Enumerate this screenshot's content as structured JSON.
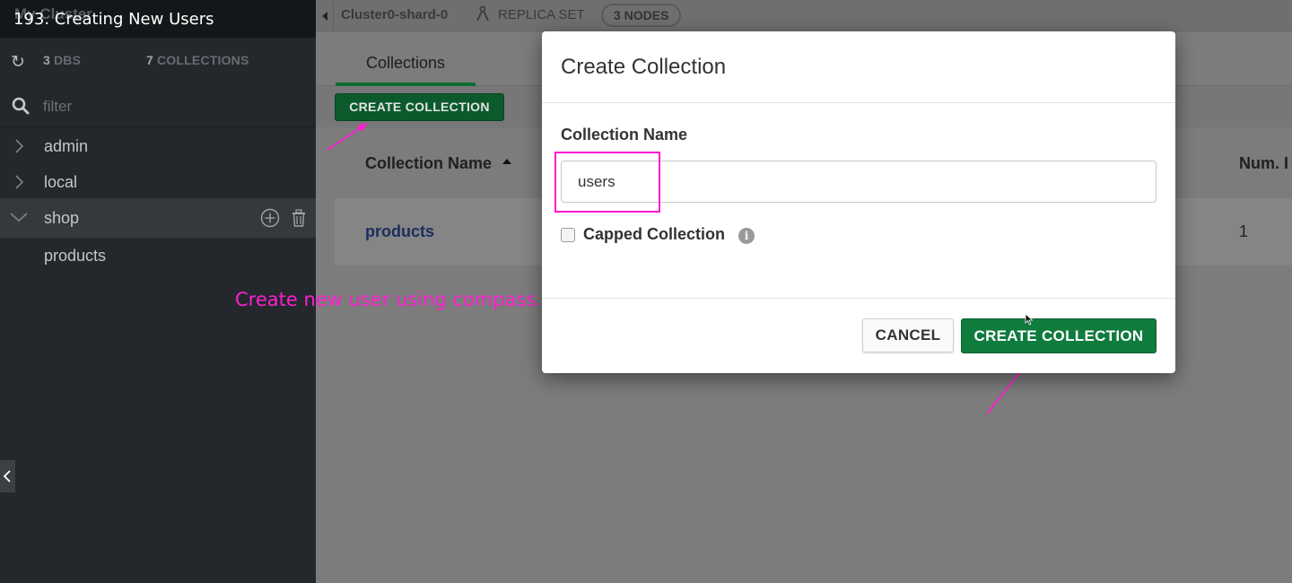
{
  "video": {
    "title": "193. Creating New Users",
    "cluster_label": "My Cluster"
  },
  "sidebar": {
    "stats": {
      "dbs_count": "3",
      "dbs_label": "DBS",
      "collections_count": "7",
      "collections_label": "COLLECTIONS"
    },
    "filter_placeholder": "filter",
    "databases": [
      {
        "name": "admin",
        "expanded": false
      },
      {
        "name": "local",
        "expanded": false
      },
      {
        "name": "shop",
        "expanded": true,
        "collections": [
          "products"
        ]
      }
    ]
  },
  "header": {
    "shard": "Cluster0-shard-0",
    "topology": "REPLICA SET",
    "nodes": "3 NODES"
  },
  "main": {
    "tab_label": "Collections",
    "create_button": "CREATE COLLECTION",
    "table": {
      "columns": [
        "Collection Name",
        "Num. I"
      ],
      "rows": [
        {
          "name": "products",
          "num": "1"
        }
      ]
    }
  },
  "modal": {
    "title": "Create Collection",
    "field_label": "Collection Name",
    "field_value": "users",
    "capped_label": "Capped Collection",
    "capped_checked": false,
    "cancel_label": "CANCEL",
    "create_label": "CREATE COLLECTION"
  },
  "annotation": {
    "text": "Create new user using compass."
  },
  "colors": {
    "accent_green": "#0f7b3d",
    "annotation_magenta": "#ff1fd0",
    "sidebar_bg": "#24282c"
  },
  "icons": [
    "refresh-icon",
    "search-icon",
    "chevron-right-icon",
    "chevron-down-icon",
    "add-circle-icon",
    "trash-icon",
    "chevron-left-icon",
    "replica-set-icon",
    "sort-asc-icon",
    "info-icon"
  ]
}
